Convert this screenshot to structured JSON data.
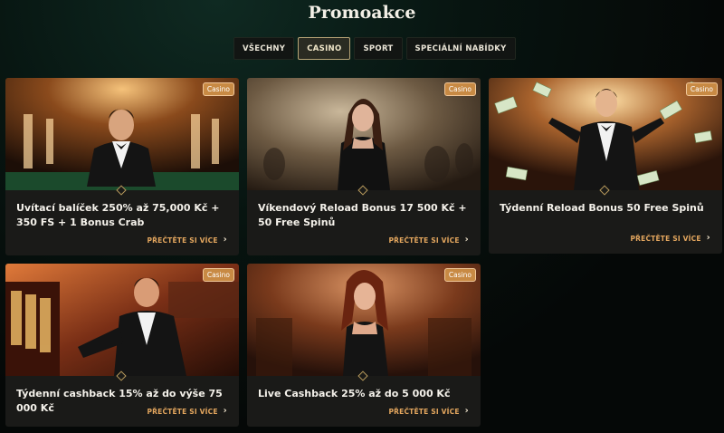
{
  "page": {
    "title": "Promoakce"
  },
  "tabs": [
    {
      "label": "VŠECHNY",
      "active": false
    },
    {
      "label": "CASINO",
      "active": true
    },
    {
      "label": "SPORT",
      "active": false
    },
    {
      "label": "SPECIÁLNÍ NABÍDKY",
      "active": false
    }
  ],
  "cards": [
    {
      "badge": "Casino",
      "title": "Uvítací balíček 250% až 75,000 Kč + 350 FS + 1 Bonus Crab",
      "more": "PŘEČTĚTE SI VÍCE",
      "chevron": "›"
    },
    {
      "badge": "Casino",
      "title": "Víkendový Reload Bonus 17 500 Kč + 50 Free Spinů",
      "more": "PŘEČTĚTE SI VÍCE",
      "chevron": "›"
    },
    {
      "badge": "Casino",
      "title": "Týdenní Reload Bonus 50 Free Spinů",
      "more": "PŘEČTĚTE SI VÍCE",
      "chevron": "›"
    },
    {
      "badge": "Casino",
      "title": "Týdenní cashback 15% až do výše 75 000 Kč",
      "more": "PŘEČTĚTE SI VÍCE",
      "chevron": "›"
    },
    {
      "badge": "Casino",
      "title": "Live Cashback 25% až do 5 000 Kč",
      "more": "PŘEČTĚTE SI VÍCE",
      "chevron": "›"
    }
  ],
  "colors": {
    "accent": "#e3a65e",
    "badge": "#c88a44",
    "card_bg": "#1a1a18"
  }
}
